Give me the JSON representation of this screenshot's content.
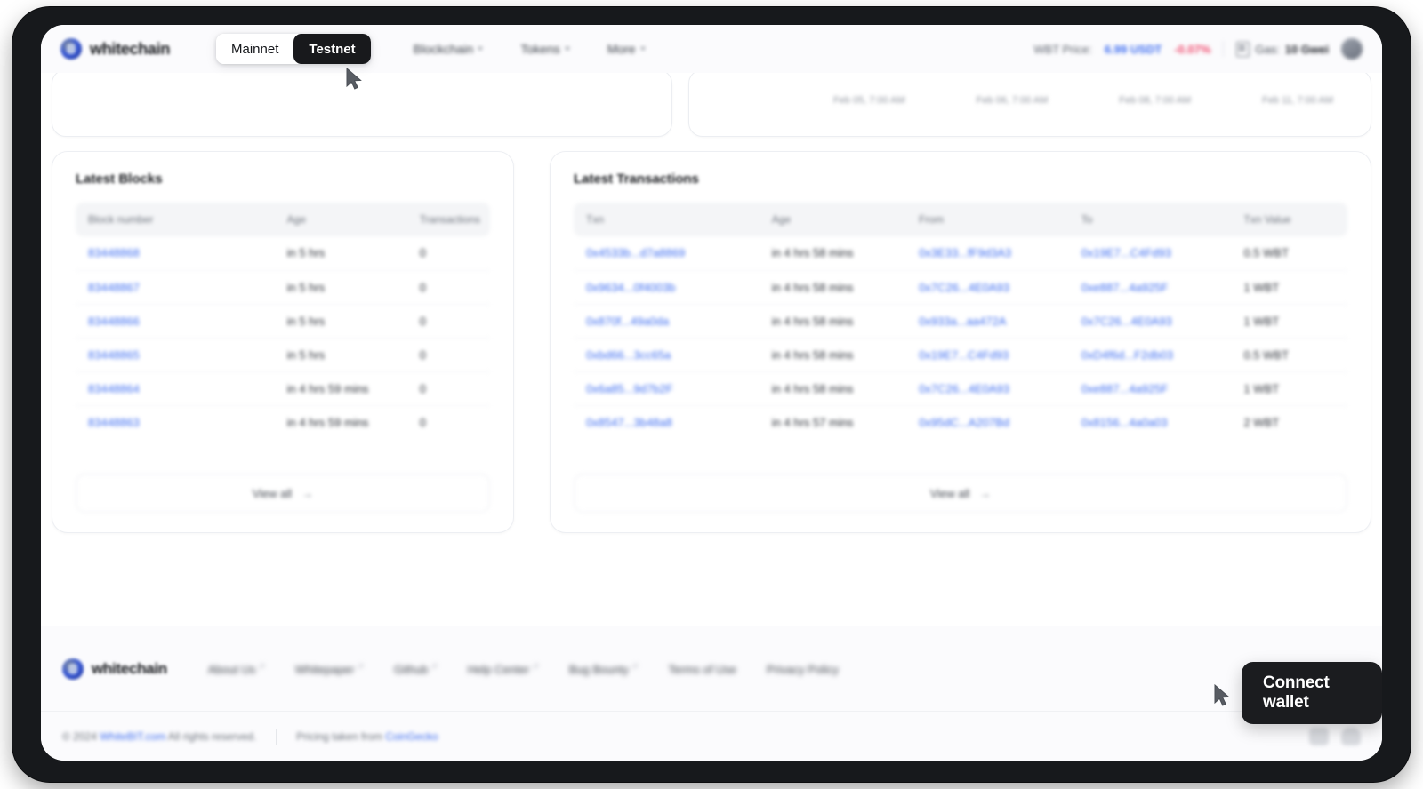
{
  "header": {
    "logo_text": "whitechain",
    "network": {
      "mainnet": "Mainnet",
      "testnet": "Testnet",
      "active": "Testnet"
    },
    "nav": [
      {
        "label": "Blockchain"
      },
      {
        "label": "Tokens"
      },
      {
        "label": "More"
      }
    ],
    "price": {
      "label": "WBT Price:",
      "value": "6.99 USDT",
      "change": "-0.07%"
    },
    "gas": {
      "label": "Gas:",
      "value": "10 Gwei"
    }
  },
  "chart_axis": {
    "labels": [
      "Feb 05, 7:00 AM",
      "Feb 06, 7:00 AM",
      "Feb 08, 7:00 AM",
      "Feb 11, 7:00 AM"
    ]
  },
  "blocks": {
    "title": "Latest Blocks",
    "columns": [
      "Block number",
      "Age",
      "Transactions"
    ],
    "rows": [
      {
        "number": "83448868",
        "age": "in 5 hrs",
        "txs": "0"
      },
      {
        "number": "83448867",
        "age": "in 5 hrs",
        "txs": "0"
      },
      {
        "number": "83448866",
        "age": "in 5 hrs",
        "txs": "0"
      },
      {
        "number": "83448865",
        "age": "in 5 hrs",
        "txs": "0"
      },
      {
        "number": "83448864",
        "age": "in 4 hrs 59 mins",
        "txs": "0"
      },
      {
        "number": "83448863",
        "age": "in 4 hrs 59 mins",
        "txs": "0"
      }
    ],
    "view_all": "View all",
    "view_all_arrow": "→"
  },
  "transactions": {
    "title": "Latest Transactions",
    "columns": [
      "Txn",
      "Age",
      "From",
      "To",
      "Txn Value"
    ],
    "rows": [
      {
        "txn": "0x4533b...d7a8869",
        "age": "in 4 hrs 58 mins",
        "from": "0x3E33...fF9d3A3",
        "to": "0x19E7...C4Fd93",
        "value": "0.5 WBT"
      },
      {
        "txn": "0x9634...0f4003b",
        "age": "in 4 hrs 58 mins",
        "from": "0x7C26...4E0A93",
        "to": "0xe887...4a925F",
        "value": "1 WBT"
      },
      {
        "txn": "0x870f...49a0da",
        "age": "in 4 hrs 58 mins",
        "from": "0x933a...aa472A",
        "to": "0x7C26...4E0A93",
        "value": "1 WBT"
      },
      {
        "txn": "0xbd66...3cc65a",
        "age": "in 4 hrs 58 mins",
        "from": "0x19E7...C4Fd93",
        "to": "0xD4f6d...F2db03",
        "value": "0.5 WBT"
      },
      {
        "txn": "0x6a85...9d7b2F",
        "age": "in 4 hrs 58 mins",
        "from": "0x7C26...4E0A93",
        "to": "0xe887...4a925F",
        "value": "1 WBT"
      },
      {
        "txn": "0x8547...3b48a8",
        "age": "in 4 hrs 57 mins",
        "from": "0x95dC...A207Bd",
        "to": "0x8156...4a0a03",
        "value": "2 WBT"
      }
    ],
    "view_all": "View all",
    "view_all_arrow": "→"
  },
  "footer": {
    "logo_text": "whitechain",
    "links": [
      {
        "label": "About Us",
        "external": true
      },
      {
        "label": "Whitepaper",
        "external": true
      },
      {
        "label": "Github",
        "external": true
      },
      {
        "label": "Help Center",
        "external": true
      },
      {
        "label": "Bug Bounty",
        "external": true
      },
      {
        "label": "Terms of Use",
        "external": false
      },
      {
        "label": "Privacy Policy",
        "external": false
      }
    ],
    "copyright_pre": "© 2024 ",
    "copyright_brand": "WhiteBIT.com",
    "copyright_post": " All rights reserved.",
    "pricing_pre": "Pricing taken from ",
    "pricing_brand": "CoinGecko"
  },
  "tooltip": {
    "connect_wallet": "Connect wallet"
  },
  "colors": {
    "accent_blue": "#3b6bf0",
    "negative_red": "#f0476b",
    "dark": "#18191c",
    "frame": "#17191c"
  }
}
